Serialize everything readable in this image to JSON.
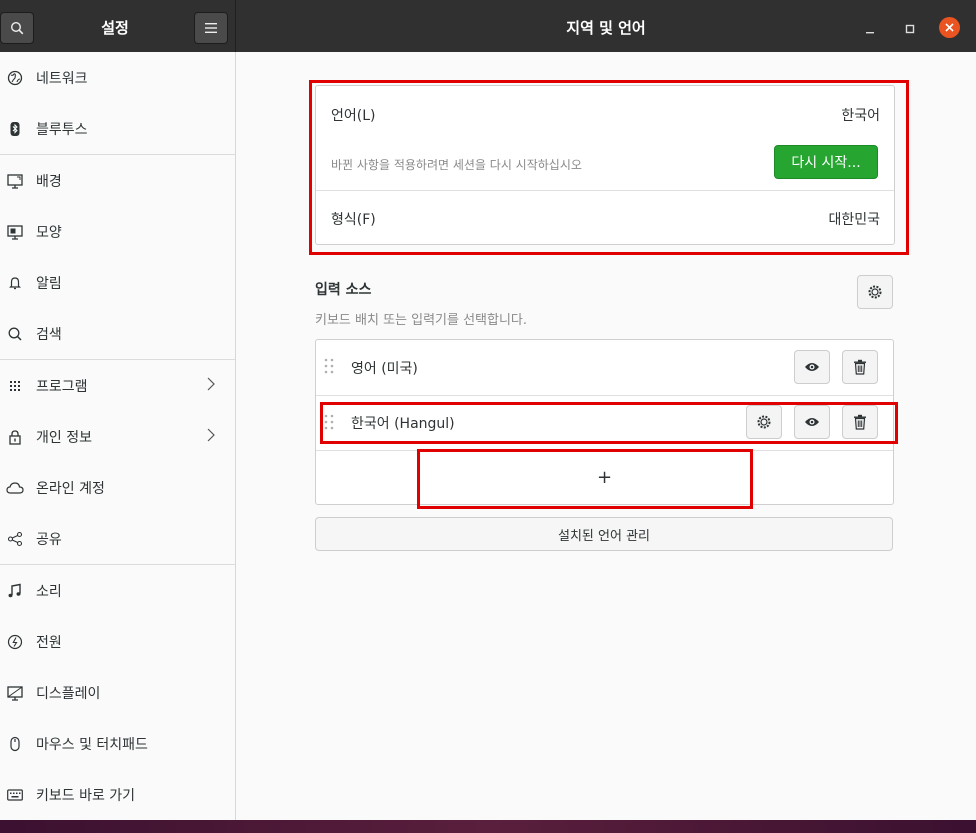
{
  "header": {
    "sidebar_title": "설정",
    "window_title": "지역 및 언어",
    "close_color": "#e95420"
  },
  "sidebar": {
    "items": [
      {
        "label": "네트워크",
        "icon": "network-icon"
      },
      {
        "label": "블루투스",
        "icon": "bluetooth-icon"
      },
      {
        "label": "배경",
        "icon": "background-icon"
      },
      {
        "label": "모양",
        "icon": "appearance-icon"
      },
      {
        "label": "알림",
        "icon": "bell-icon"
      },
      {
        "label": "검색",
        "icon": "search-icon"
      },
      {
        "label": "프로그램",
        "icon": "apps-grid-icon",
        "chevron": true
      },
      {
        "label": "개인 정보",
        "icon": "lock-icon",
        "chevron": true
      },
      {
        "label": "온라인 계정",
        "icon": "cloud-icon"
      },
      {
        "label": "공유",
        "icon": "share-icon"
      },
      {
        "label": "소리",
        "icon": "music-note-icon"
      },
      {
        "label": "전원",
        "icon": "power-icon"
      },
      {
        "label": "디스플레이",
        "icon": "display-icon"
      },
      {
        "label": "마우스 및 터치패드",
        "icon": "mouse-icon"
      },
      {
        "label": "키보드 바로 가기",
        "icon": "keyboard-icon"
      }
    ]
  },
  "language": {
    "label": "언어(L)",
    "value": "한국어",
    "restart_hint": "바뀐 사항을 적용하려면 세션을 다시 시작하십시오",
    "restart_button": "다시 시작...",
    "accent": "#26a531"
  },
  "formats": {
    "label": "형식(F)",
    "value": "대한민국"
  },
  "input_sources": {
    "title": "입력 소스",
    "subtitle": "키보드 배치 또는 입력기를 선택합니다.",
    "items": [
      {
        "label": "영어 (미국)"
      },
      {
        "label": "한국어 (Hangul)"
      }
    ],
    "add_label": "+"
  },
  "manage_languages_button": "설치된 언어 관리",
  "highlight_color": "#e10000"
}
